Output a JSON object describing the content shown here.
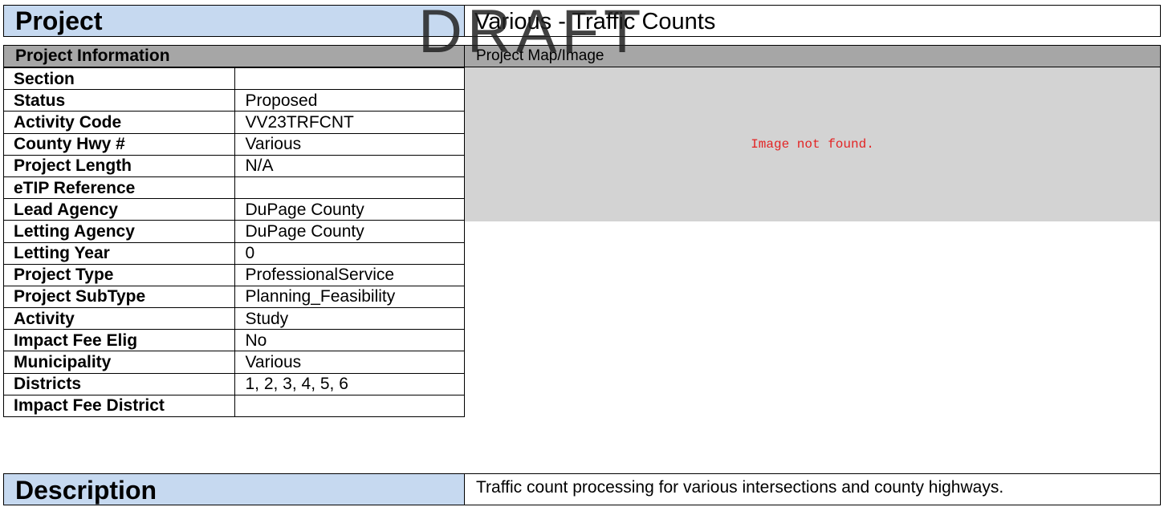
{
  "watermark": "DRAFT",
  "title": {
    "label": "Project",
    "name": "Various - Traffic Counts"
  },
  "sections": {
    "info_header": "Project Information",
    "map_header": "Project Map/Image",
    "map_message": "Image not found."
  },
  "fields": [
    {
      "label": "Section",
      "value": ""
    },
    {
      "label": "Status",
      "value": "Proposed"
    },
    {
      "label": "Activity Code",
      "value": "VV23TRFCNT"
    },
    {
      "label": "County Hwy #",
      "value": "Various"
    },
    {
      "label": "Project Length",
      "value": "N/A"
    },
    {
      "label": "eTIP Reference",
      "value": ""
    },
    {
      "label": "Lead Agency",
      "value": "DuPage County"
    },
    {
      "label": "Letting Agency",
      "value": "DuPage County"
    },
    {
      "label": "Letting Year",
      "value": "0"
    },
    {
      "label": "Project Type",
      "value": "ProfessionalService"
    },
    {
      "label": "Project SubType",
      "value": "Planning_Feasibility"
    },
    {
      "label": "Activity",
      "value": "Study"
    },
    {
      "label": "Impact Fee Elig",
      "value": "No"
    },
    {
      "label": "Municipality",
      "value": "Various"
    },
    {
      "label": "Districts",
      "value": "1, 2, 3, 4, 5, 6"
    },
    {
      "label": "Impact Fee District",
      "value": ""
    }
  ],
  "description": {
    "label": "Description",
    "text": "Traffic count processing for various intersections and county highways."
  }
}
